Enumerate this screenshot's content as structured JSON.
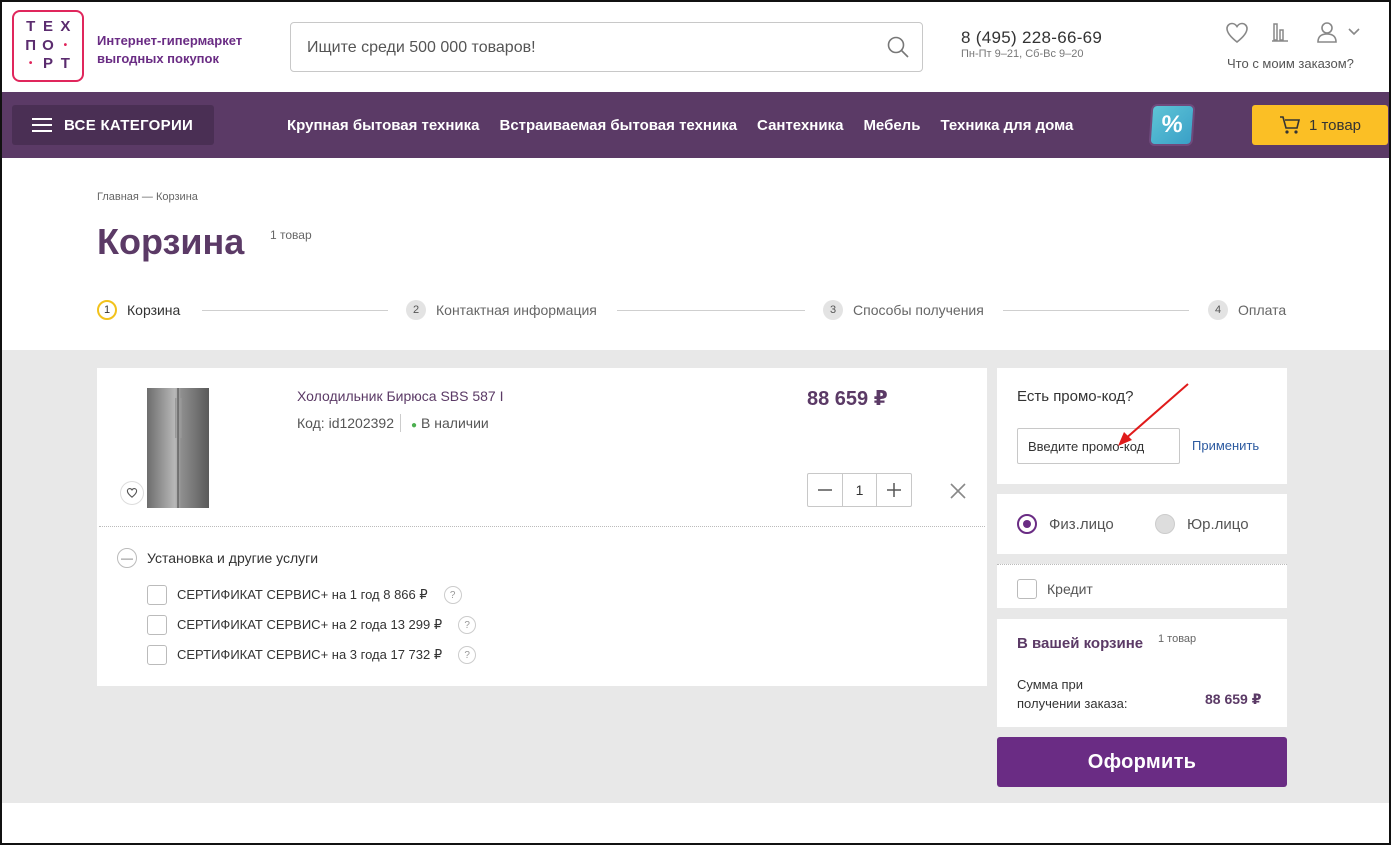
{
  "logo": {
    "row1": [
      "Т",
      "Е",
      "Х"
    ],
    "row2": [
      "П",
      "О",
      "•"
    ],
    "row3": [
      "•",
      "Р",
      "Т"
    ]
  },
  "header": {
    "tagline": "Интернет-гипермаркет выгодных покупок",
    "search_placeholder": "Ищите среди 500 000 товаров!",
    "phone": "8 (495) 228-66-69",
    "hours": "Пн-Пт 9–21, Сб-Вс 9–20",
    "order_status": "Что с моим заказом?"
  },
  "nav": {
    "all_categories": "ВСЕ КАТЕГОРИИ",
    "links": [
      "Крупная бытовая техника",
      "Встраиваемая бытовая техника",
      "Сантехника",
      "Мебель",
      "Техника для дома"
    ],
    "promo_badge": "%",
    "cart_label": "1 товар"
  },
  "breadcrumb": "Главная — Корзина",
  "page": {
    "title": "Корзина",
    "count": "1 товар"
  },
  "steps": [
    {
      "num": "1",
      "label": "Корзина"
    },
    {
      "num": "2",
      "label": "Контактная информация"
    },
    {
      "num": "3",
      "label": "Способы получения"
    },
    {
      "num": "4",
      "label": "Оплата"
    }
  ],
  "product": {
    "name": "Холодильник Бирюса SBS 587 I",
    "code": "Код: id1202392",
    "stock": "В наличии",
    "price": "88 659 ₽",
    "qty": "1",
    "services_title": "Установка и другие услуги",
    "services": [
      "СЕРТИФИКАТ СЕРВИС+ на 1 год 8 866 ₽",
      "СЕРТИФИКАТ СЕРВИС+ на 2 года 13 299 ₽",
      "СЕРТИФИКАТ СЕРВИС+ на 3 года 17 732 ₽"
    ]
  },
  "promo": {
    "title": "Есть промо-код?",
    "placeholder": "Введите промо-код",
    "apply": "Применить"
  },
  "buyer": {
    "individual": "Физ.лицо",
    "company": "Юр.лицо"
  },
  "credit": "Кредит",
  "summary": {
    "title": "В вашей корзине",
    "count": "1 товар",
    "label": "Сумма при получении заказа:",
    "value": "88 659 ₽"
  },
  "checkout": "Оформить",
  "colors": {
    "brand": "#6a2c84",
    "nav": "#5b3a66",
    "accent": "#fbbf25",
    "logo_border": "#e0265c"
  }
}
